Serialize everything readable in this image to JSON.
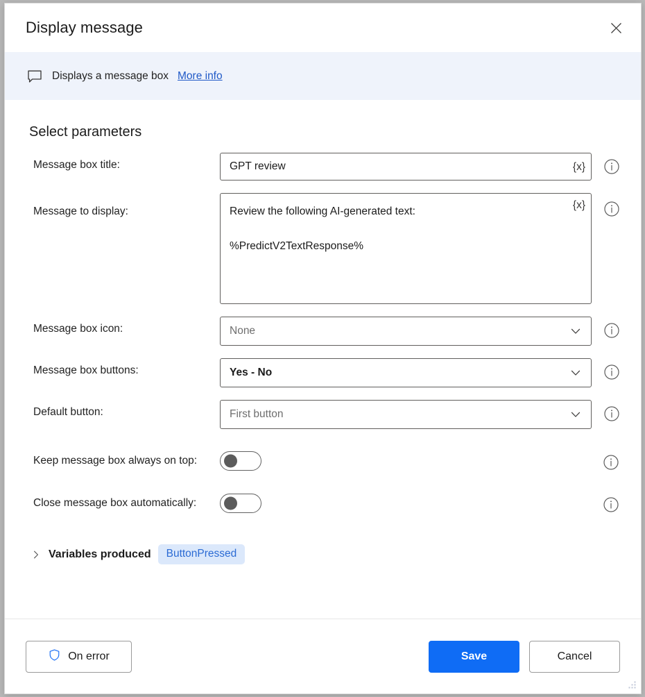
{
  "window": {
    "title": "Display message",
    "close_icon": "close-icon"
  },
  "banner": {
    "icon": "message-bubble-icon",
    "text": "Displays a message box",
    "link_label": "More info"
  },
  "main": {
    "section_title": "Select parameters",
    "fields": [
      {
        "label": "Message box title:",
        "type": "text",
        "value": "GPT review",
        "variable_button": "{x}",
        "info_icon": "info-icon"
      },
      {
        "label": "Message to display:",
        "type": "textarea",
        "value": "Review the following AI-generated text:\n\n%PredictV2TextResponse%",
        "variable_button": "{x}",
        "info_icon": "info-icon"
      },
      {
        "label": "Message box icon:",
        "type": "select",
        "value": "None",
        "value_style": "dim",
        "info_icon": "info-icon"
      },
      {
        "label": "Message box buttons:",
        "type": "select",
        "value": "Yes - No",
        "value_style": "strong",
        "info_icon": "info-icon"
      },
      {
        "label": "Default button:",
        "type": "select",
        "value": "First button",
        "value_style": "dim",
        "info_icon": "info-icon"
      }
    ],
    "toggles": [
      {
        "label": "Keep message box always on top:",
        "state": "off",
        "info_icon": "info-icon"
      },
      {
        "label": "Close message box automatically:",
        "state": "off",
        "info_icon": "info-icon"
      }
    ],
    "variables_produced": {
      "title": "Variables produced",
      "expanded": false,
      "chevron_icon": "chevron-right-icon",
      "variables": [
        "ButtonPressed"
      ]
    }
  },
  "footer": {
    "on_error_label": "On error",
    "on_error_icon": "shield-icon",
    "save_label": "Save",
    "cancel_label": "Cancel"
  },
  "colors": {
    "accent": "#0f6cf5",
    "link": "#2059c7",
    "banner_bg": "#eff3fb",
    "pill_bg": "#dbe8fb",
    "pill_text": "#2b6bd4",
    "border": "#605e5c"
  }
}
